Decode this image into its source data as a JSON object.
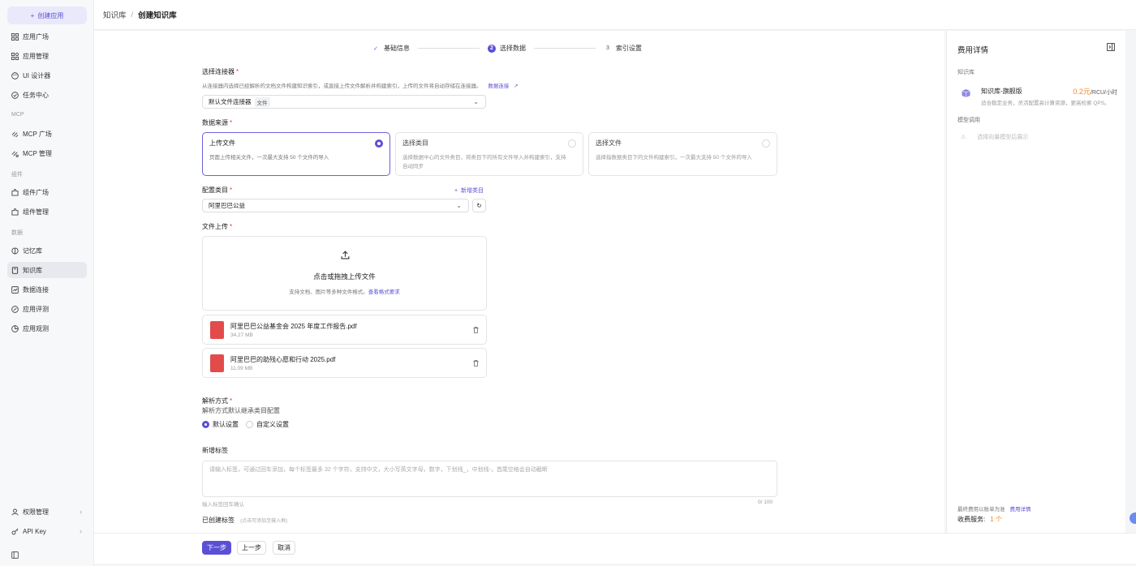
{
  "sidebar": {
    "create_button": "创建应用",
    "items": [
      {
        "label": "应用广场"
      },
      {
        "label": "应用管理"
      },
      {
        "label": "UI 设计器"
      },
      {
        "label": "任务中心"
      },
      {
        "label": "MCP 广场"
      },
      {
        "label": "MCP 管理"
      },
      {
        "label": "组件广场"
      },
      {
        "label": "组件管理"
      },
      {
        "label": "记忆库"
      },
      {
        "label": "知识库"
      },
      {
        "label": "数据连接"
      },
      {
        "label": "应用评测"
      },
      {
        "label": "应用观测"
      }
    ],
    "groups": {
      "mcp": "MCP",
      "component": "组件",
      "data": "数据"
    },
    "bottom": [
      {
        "label": "权限管理"
      },
      {
        "label": "API Key"
      }
    ]
  },
  "breadcrumb": {
    "parent": "知识库",
    "separator": "/",
    "current": "创建知识库"
  },
  "steps": [
    {
      "index": "1",
      "label": "基础信息",
      "state": "done"
    },
    {
      "index": "2",
      "label": "选择数据",
      "state": "current"
    },
    {
      "index": "3",
      "label": "索引设置",
      "state": "todo"
    }
  ],
  "form": {
    "connector": {
      "label": "选择连接器",
      "hint": "从连接器内选择已经解析的文档文件构建知识索引，或直接上传文件解析并构建索引，上传的文件将自动存储在连接器。",
      "hint_link": "数据连接",
      "value": "默认文件连接器",
      "value_tag": "文件"
    },
    "source": {
      "label": "数据来源",
      "options": [
        {
          "title": "上传文件",
          "desc": "页面上传相关文件，一次最大支持 50 个文件的导入"
        },
        {
          "title": "选择类目",
          "desc": "选择数据中心的文件类目，将类目下的所有文件导入并构建索引，支持自动同步"
        },
        {
          "title": "选择文件",
          "desc": "选择指数据类目下的文件构建索引，一次最大支持 50 个文件的导入"
        }
      ]
    },
    "category": {
      "label": "配置类目",
      "add_label": "新增类目",
      "value": "阿里巴巴公益"
    },
    "upload": {
      "label": "文件上传",
      "title": "点击或拖拽上传文件",
      "hint": "支持文档、图片等多种文件格式。",
      "hint_link": "查看格式要求"
    },
    "files": [
      {
        "name": "阿里巴巴公益基金会 2025 年度工作报告.pdf",
        "size": "34.27 MB"
      },
      {
        "name": "阿里巴巴的助残心愿和行动 2025.pdf",
        "size": "11.09 MB"
      }
    ],
    "parse": {
      "label": "解析方式",
      "hint": "解析方式默认继承类目配置",
      "options": [
        "默认设置",
        "自定义设置"
      ]
    },
    "tags": {
      "label": "新增标签",
      "placeholder": "请输入标签，可通过回车添加，每个标签最多 32 个字符，支持中文，大小写英文字母，数字，下划线_，中划线-，首尾空格会自动截断",
      "below_hint": "输入标签回车确认",
      "counter": "0/ 100"
    },
    "created_tags": {
      "label": "已创建标签",
      "hint": "(点击可添加至输入框)"
    }
  },
  "footer": {
    "next": "下一步",
    "prev": "上一步",
    "cancel": "取消"
  },
  "right_panel": {
    "title": "费用详情",
    "kb_section": "知识库",
    "kb_item": {
      "name": "知识库-旗舰版",
      "price": "0.2元",
      "unit": "/RCU/小时",
      "desc": "适合稳定业务，灵活配置高计算资源，更高检索 QPS。"
    },
    "model_section": "模型调用",
    "model_placeholder": "选择向量模型后展示",
    "bottom_note": "最终费用以账单为准",
    "bottom_link": "费用详情",
    "service_label": "收费服务:",
    "service_count": "1 个"
  },
  "colors": {
    "accent": "#5b4fd6",
    "price": "#f08a24",
    "pdf": "#e34b4b"
  }
}
